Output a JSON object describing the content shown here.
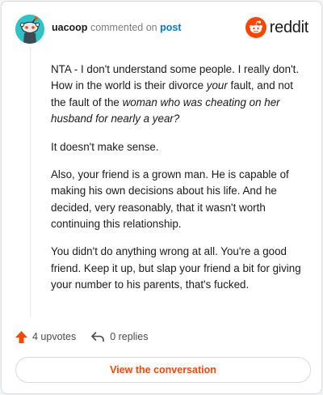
{
  "header": {
    "username": "uacoop",
    "verb": "commented on",
    "post_link": "post",
    "brand": "reddit"
  },
  "comment": {
    "p1_a": "NTA - I don't understand some people. I really don't. How in the world is their divorce ",
    "p1_b": "your",
    "p1_c": " fault, and not the fault of the ",
    "p1_d": "woman who was cheating on her husband for nearly a year?",
    "p2": "It doesn't make sense.",
    "p3": "Also, your friend is a grown man. He is capable of making his own decisions about his life. And he decided, very reasonably, that it wasn't worth continuing this relationship.",
    "p4": "You didn't do anything wrong at all. You're a good friend. Keep it up, but slap your friend a bit for giving your number to his parents, that's fucked."
  },
  "actions": {
    "upvotes": "4 upvotes",
    "replies": "0 replies"
  },
  "cta": {
    "label": "View the conversation"
  },
  "colors": {
    "brand_orange": "#ff4500",
    "link_blue": "#0079d3",
    "avatar_teal": "#2ec4c6"
  },
  "icons": [
    "snoo-avatar-icon",
    "reddit-logo-icon",
    "upvote-arrow-icon",
    "reply-arrow-icon"
  ]
}
